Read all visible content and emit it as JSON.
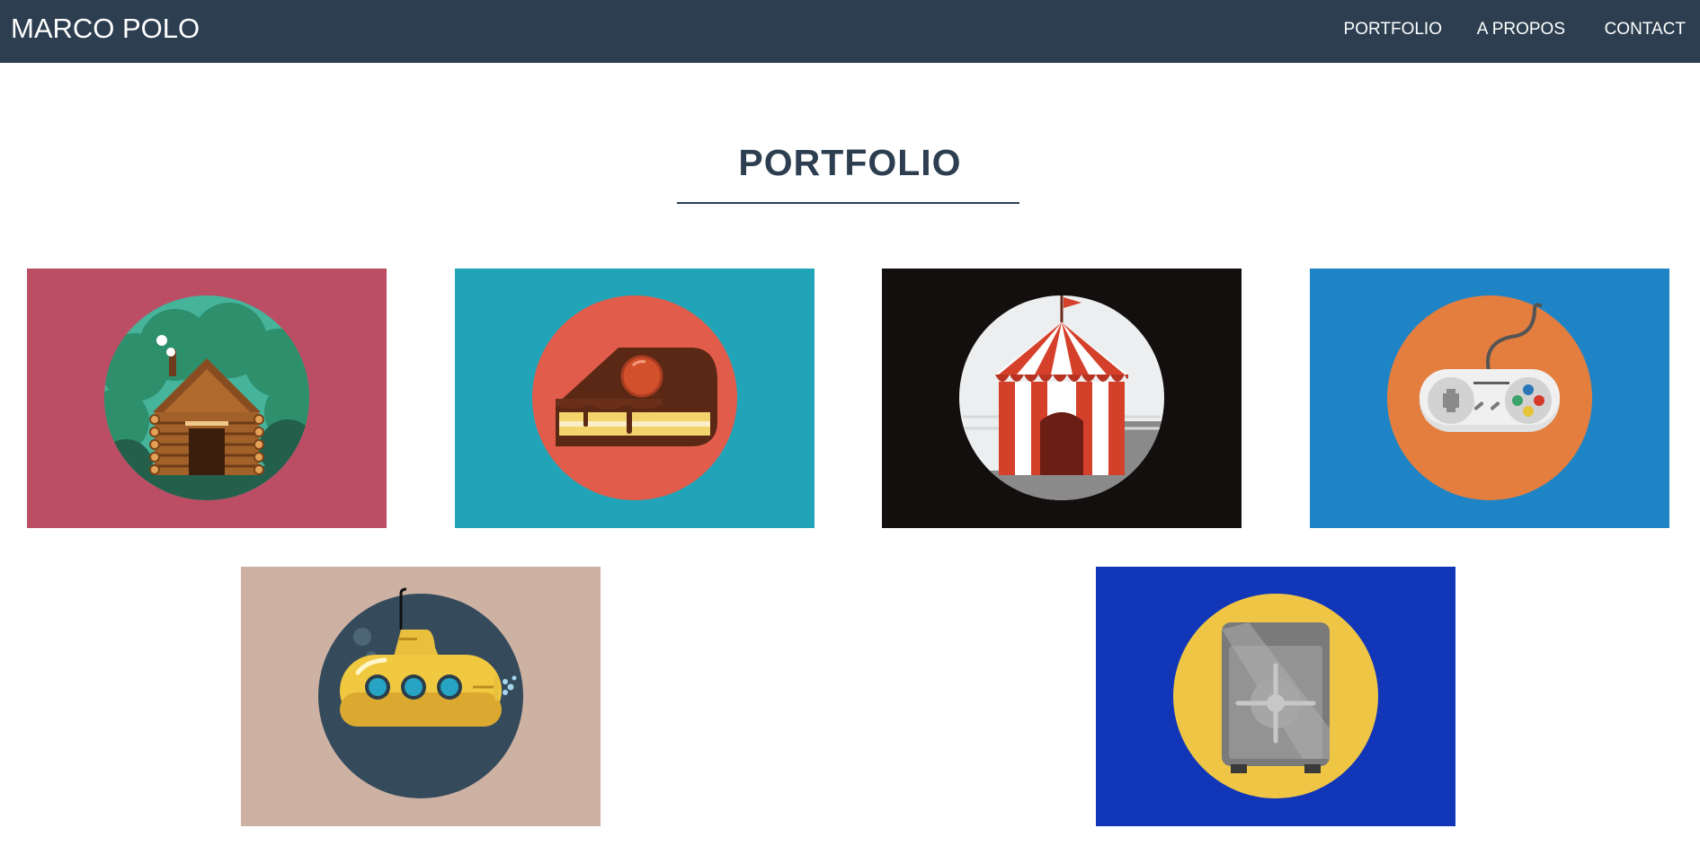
{
  "navbar": {
    "brand": "MARCO POLO",
    "links": [
      "PORTFOLIO",
      "A PROPOS",
      "CONTACT"
    ],
    "background": "#2c3e50"
  },
  "portfolio": {
    "title": "PORTFOLIO",
    "items": [
      {
        "icon": "log-cabin-icon",
        "background": "#bb4e64",
        "circle": "#46b39b"
      },
      {
        "icon": "cake-slice-icon",
        "background": "#21a4b7",
        "circle": "#e25c4b"
      },
      {
        "icon": "circus-tent-icon",
        "background": "#130f0e",
        "circle": "#eceeef"
      },
      {
        "icon": "game-controller-icon",
        "background": "#1e84c5",
        "circle": "#e37e3f"
      },
      {
        "icon": "submarine-icon",
        "background": "#cdb2a4",
        "circle": "#354b5c"
      },
      {
        "icon": "safe-icon",
        "background": "#1136b8",
        "circle": "#efc545"
      }
    ]
  }
}
